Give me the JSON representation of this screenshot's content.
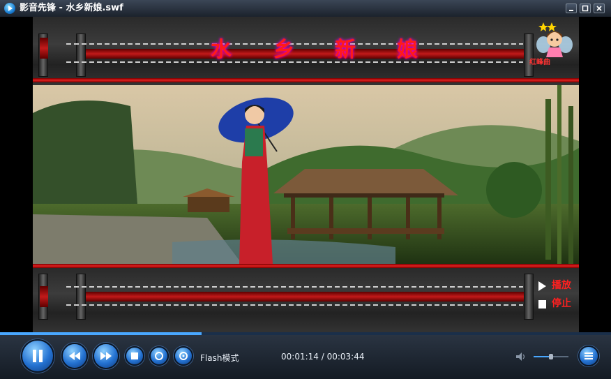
{
  "window": {
    "title": "影音先锋 - 水乡新娘.swf",
    "minimize_label": "minimize",
    "maximize_label": "maximize",
    "close_label": "close"
  },
  "content": {
    "banner_title_chars": [
      "水",
      "乡",
      "新",
      "娘"
    ],
    "mascot_caption": "红峰曲",
    "side_controls": [
      {
        "icon": "play-triangle-icon",
        "label": "播放"
      },
      {
        "icon": "stop-square-icon",
        "label": "停止"
      }
    ]
  },
  "player": {
    "progress_fraction": 0.33,
    "mode_label": "Flash模式",
    "time_current": "00:01:14",
    "time_total": "00:03:44",
    "time_display": "00:01:14 / 00:03:44",
    "volume_fraction": 0.5,
    "buttons": [
      {
        "name": "pause-button",
        "icon": "pause-icon"
      },
      {
        "name": "rewind-button",
        "icon": "rewind-icon"
      },
      {
        "name": "forward-button",
        "icon": "fast-forward-icon"
      },
      {
        "name": "stop-button",
        "icon": "stop-icon"
      },
      {
        "name": "repeat-button",
        "icon": "repeat-icon"
      },
      {
        "name": "open-button",
        "icon": "open-file-icon"
      },
      {
        "name": "playlist-button",
        "icon": "playlist-icon"
      }
    ]
  },
  "colors": {
    "accent": "#49a7ff",
    "banner_red": "#ff1a1a",
    "titlebar": "#2b3440"
  }
}
